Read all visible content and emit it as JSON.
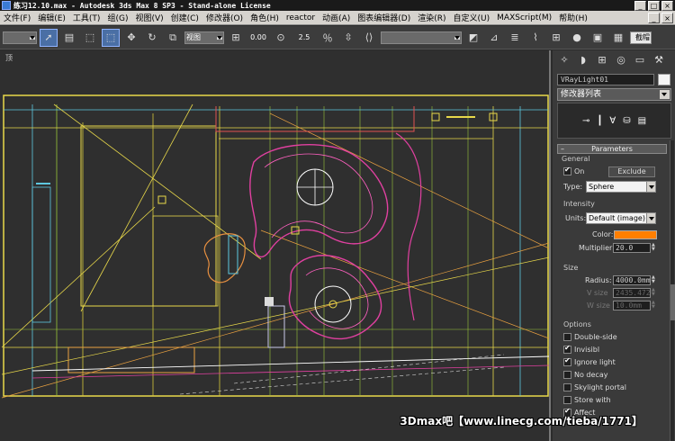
{
  "window": {
    "title": "练习12.10.max - Autodesk 3ds Max 8 SP3  - Stand-alone License",
    "buttons": [
      "_",
      "□",
      "×"
    ]
  },
  "menubar": {
    "items": [
      "文件(F)",
      "编辑(E)",
      "工具(T)",
      "组(G)",
      "视图(V)",
      "创建(C)",
      "修改器(O)",
      "角色(H)",
      "reactor",
      "动画(A)",
      "图表编辑器(D)",
      "渲染(R)",
      "自定义(U)",
      "MAXScript(M)",
      "帮助(H)"
    ],
    "doc_buttons": [
      "_",
      "×"
    ]
  },
  "toolbar": {
    "view_dropdown": "视图",
    "snap_value": "0.00",
    "angle_value": "2.5",
    "render_label": "截帽"
  },
  "viewport": {
    "label": "顶"
  },
  "panel": {
    "object_name": "VRayLight01",
    "modifier_list": "修改器列表",
    "parameters_title": "Parameters",
    "general": {
      "title": "General",
      "on_label": "On",
      "on_checked": true,
      "exclude_label": "Exclude",
      "type_label": "Type:",
      "type_value": "Sphere"
    },
    "intensity": {
      "title": "Intensity",
      "units_label": "Units:",
      "units_value": "Default (image)",
      "color_label": "Color:",
      "color_value": "#ff7f00",
      "multiplier_label": "Multiplier:",
      "multiplier_value": "20.0"
    },
    "size": {
      "title": "Size",
      "radius_label": "Radius:",
      "radius_value": "4000.0mm",
      "vsize_label": "V size",
      "vsize_value": "2435.472",
      "wsize_label": "W size",
      "wsize_value": "10.0mm"
    },
    "options": {
      "title": "Options",
      "items": [
        {
          "label": "Double-side",
          "checked": false
        },
        {
          "label": "Invisibl",
          "checked": true
        },
        {
          "label": "Ignore light",
          "checked": true
        },
        {
          "label": "No decay",
          "checked": false
        },
        {
          "label": "Skylight portal",
          "checked": false
        },
        {
          "label": "Store with",
          "checked": false
        },
        {
          "label": "Affect",
          "checked": true
        }
      ]
    }
  },
  "watermark": "3Dmax吧【www.linecg.com/tieba/1771】"
}
